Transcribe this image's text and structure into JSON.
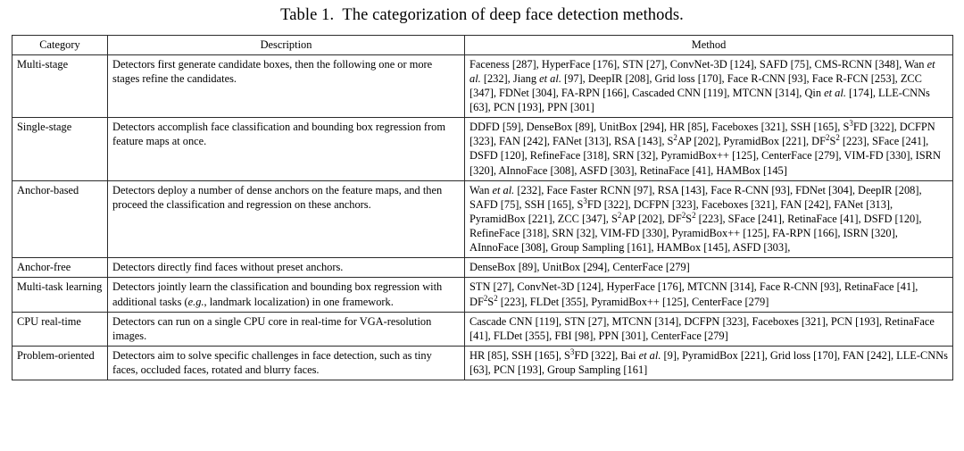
{
  "caption": "Table 1.  The categorization of deep face detection methods.",
  "table": {
    "headers": {
      "category": "Category",
      "description": "Description",
      "method": "Method"
    },
    "rows": [
      {
        "category": "Multi-stage",
        "description": "Detectors first generate candidate boxes, then the following one or more stages refine the candidates.",
        "method": "Faceness [287], HyperFace [176], STN [27], ConvNet-3D [124], SAFD [75], CMS-RCNN [348], Wan et al. [232], Jiang et al. [97], DeepIR [208], Grid loss [170], Face R-CNN [93], Face R-FCN [253], ZCC [347], FDNet [304], FA-RPN [166], Cascaded CNN [119], MTCNN [314], Qin et al. [174], LLE-CNNs [63], PCN [193], PPN [301]"
      },
      {
        "category": "Single-stage",
        "description": "Detectors accomplish face classification and bounding box regression from feature maps at once.",
        "method": "DDFD [59], DenseBox [89], UnitBox [294], HR [85], Faceboxes [321], SSH [165], S3FD [322], DCFPN [323], FAN [242], FANet [313], RSA [143], S2AP [202], PyramidBox [221], DF2S2 [223], SFace [241], DSFD [120], RefineFace [318], SRN [32], PyramidBox++ [125], CenterFace [279], VIM-FD [330], ISRN [320], AInnoFace [308], ASFD [303], RetinaFace [41], HAMBox [145]"
      },
      {
        "category": "Anchor-based",
        "description": "Detectors deploy a number of dense anchors on the feature maps, and then proceed the classification and regression on these anchors.",
        "method": "Wan et al. [232], Face Faster RCNN [97], RSA [143], Face R-CNN [93], FDNet [304], DeepIR [208], SAFD [75], SSH [165], S3FD [322], DCFPN [323], Faceboxes [321], FAN [242], FANet [313], PyramidBox [221], ZCC [347], S2AP [202], DF2S2 [223], SFace [241], RetinaFace [41], DSFD [120], RefineFace [318], SRN [32], VIM-FD [330], PyramidBox++ [125], FA-RPN [166], ISRN [320], AInnoFace [308], Group Sampling [161], HAMBox [145], ASFD [303],"
      },
      {
        "category": "Anchor-free",
        "description": "Detectors directly find faces without preset anchors.",
        "method": "DenseBox [89], UnitBox [294], CenterFace [279]"
      },
      {
        "category": "Multi-task learning",
        "description": "Detectors jointly learn the classification and bounding box regression with additional tasks (e.g., landmark localization) in one framework.",
        "method": "STN [27], ConvNet-3D [124], HyperFace [176], MTCNN [314], Face R-CNN [93], RetinaFace [41], DF2S2 [223], FLDet [355], PyramidBox++ [125], CenterFace [279]"
      },
      {
        "category": "CPU real-time",
        "description": "Detectors can run on a single CPU core in real-time for VGA-resolution images.",
        "method": "Cascade CNN [119], STN [27], MTCNN [314], DCFPN [323], Faceboxes [321], PCN [193], RetinaFace [41], FLDet [355], FBI [98], PPN [301], CenterFace [279]"
      },
      {
        "category": "Problem-oriented",
        "description": "Detectors aim to solve specific challenges in face detection, such as tiny faces, occluded faces, rotated and blurry faces.",
        "method": "HR [85], SSH [165], S3FD [322], Bai et al. [9], PyramidBox [221], Grid loss [170], FAN [242], LLE-CNNs [63], PCN [193], Group Sampling [161]"
      }
    ],
    "rendered": {
      "row0_method_html": "Faceness [287], HyperFace [176], STN [27], ConvNet-3D [124], SAFD [75], CMS-RCNN [348], Wan <i>et al.</i> [232], Jiang <i>et al.</i> [97], DeepIR [208], Grid loss [170], Face R-CNN [93], Face R-FCN [253], ZCC [347], FDNet [304], FA-RPN [166], Cascaded CNN [119], MTCNN [314], Qin <i>et al.</i> [174], LLE-CNNs [63], PCN [193], PPN [301]",
      "row1_method_html": "DDFD [59], DenseBox [89], UnitBox [294], HR [85], Faceboxes [321], SSH [165], S<sup>3</sup>FD [322], DCFPN [323], FAN [242], FANet [313], RSA [143], S<sup>2</sup>AP [202], PyramidBox [221], DF<sup>2</sup>S<sup>2</sup> [223], SFace [241], DSFD [120], RefineFace [318], SRN [32], PyramidBox++ [125], CenterFace [279], VIM-FD [330], ISRN [320], AInnoFace [308], ASFD [303], RetinaFace [41], HAMBox [145]",
      "row2_method_html": "Wan <i>et al.</i> [232], Face Faster RCNN [97], RSA [143], Face R-CNN [93], FDNet [304], DeepIR [208], SAFD [75], SSH [165], S<sup>3</sup>FD [322], DCFPN [323], Faceboxes [321], FAN [242], FANet [313], PyramidBox [221], ZCC [347], S<sup>2</sup>AP [202], DF<sup>2</sup>S<sup>2</sup> [223], SFace [241], RetinaFace [41], DSFD [120], RefineFace [318], SRN [32], VIM-FD [330], PyramidBox++ [125], FA-RPN [166], ISRN [320], AInnoFace [308], Group Sampling [161], HAMBox [145], ASFD [303],",
      "row3_method_html": "DenseBox [89], UnitBox [294], CenterFace [279]",
      "row4_method_html": "STN [27], ConvNet-3D [124], HyperFace [176], MTCNN [314], Face R-CNN [93], RetinaFace [41], DF<sup>2</sup>S<sup>2</sup> [223], FLDet [355], PyramidBox++ [125], CenterFace [279]",
      "row5_method_html": "Cascade CNN [119], STN [27], MTCNN [314], DCFPN [323], Faceboxes [321], PCN [193], RetinaFace [41], FLDet [355], FBI [98], PPN [301], CenterFace [279]",
      "row6_method_html": "HR [85], SSH [165], S<sup>3</sup>FD [322], Bai <i>et al.</i> [9], PyramidBox [221], Grid loss [170], FAN [242], LLE-CNNs [63], PCN [193], Group Sampling [161]",
      "row4_desc_html": "Detectors jointly learn the classification and bounding box regression with additional tasks (<i>e.g.</i>, landmark localization) in one framework."
    }
  }
}
